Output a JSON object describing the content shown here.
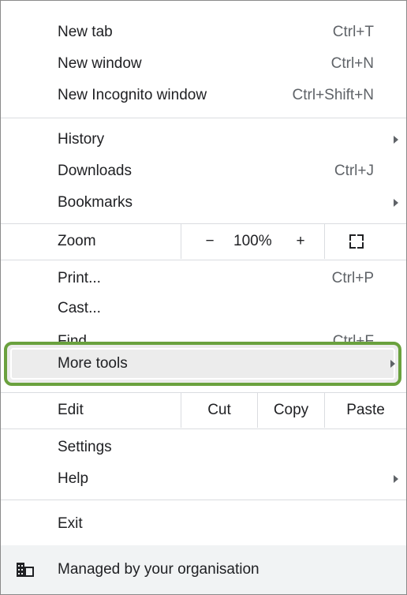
{
  "menu": {
    "new_tab": {
      "label": "New tab",
      "shortcut": "Ctrl+T"
    },
    "new_window": {
      "label": "New window",
      "shortcut": "Ctrl+N"
    },
    "new_incognito": {
      "label": "New Incognito window",
      "shortcut": "Ctrl+Shift+N"
    },
    "history": {
      "label": "History"
    },
    "downloads": {
      "label": "Downloads",
      "shortcut": "Ctrl+J"
    },
    "bookmarks": {
      "label": "Bookmarks"
    },
    "zoom": {
      "label": "Zoom",
      "minus": "−",
      "value": "100%",
      "plus": "+"
    },
    "print": {
      "label": "Print...",
      "shortcut": "Ctrl+P"
    },
    "cast": {
      "label": "Cast..."
    },
    "find": {
      "label": "Find...",
      "shortcut": "Ctrl+F"
    },
    "more_tools": {
      "label": "More tools"
    },
    "edit": {
      "label": "Edit",
      "cut": "Cut",
      "copy": "Copy",
      "paste": "Paste"
    },
    "settings": {
      "label": "Settings"
    },
    "help": {
      "label": "Help"
    },
    "exit": {
      "label": "Exit"
    },
    "managed": {
      "label": "Managed by your organisation"
    }
  },
  "colors": {
    "highlight_border": "#6aa13e",
    "hover_background": "#ececec",
    "footer_background": "#f1f3f4"
  }
}
